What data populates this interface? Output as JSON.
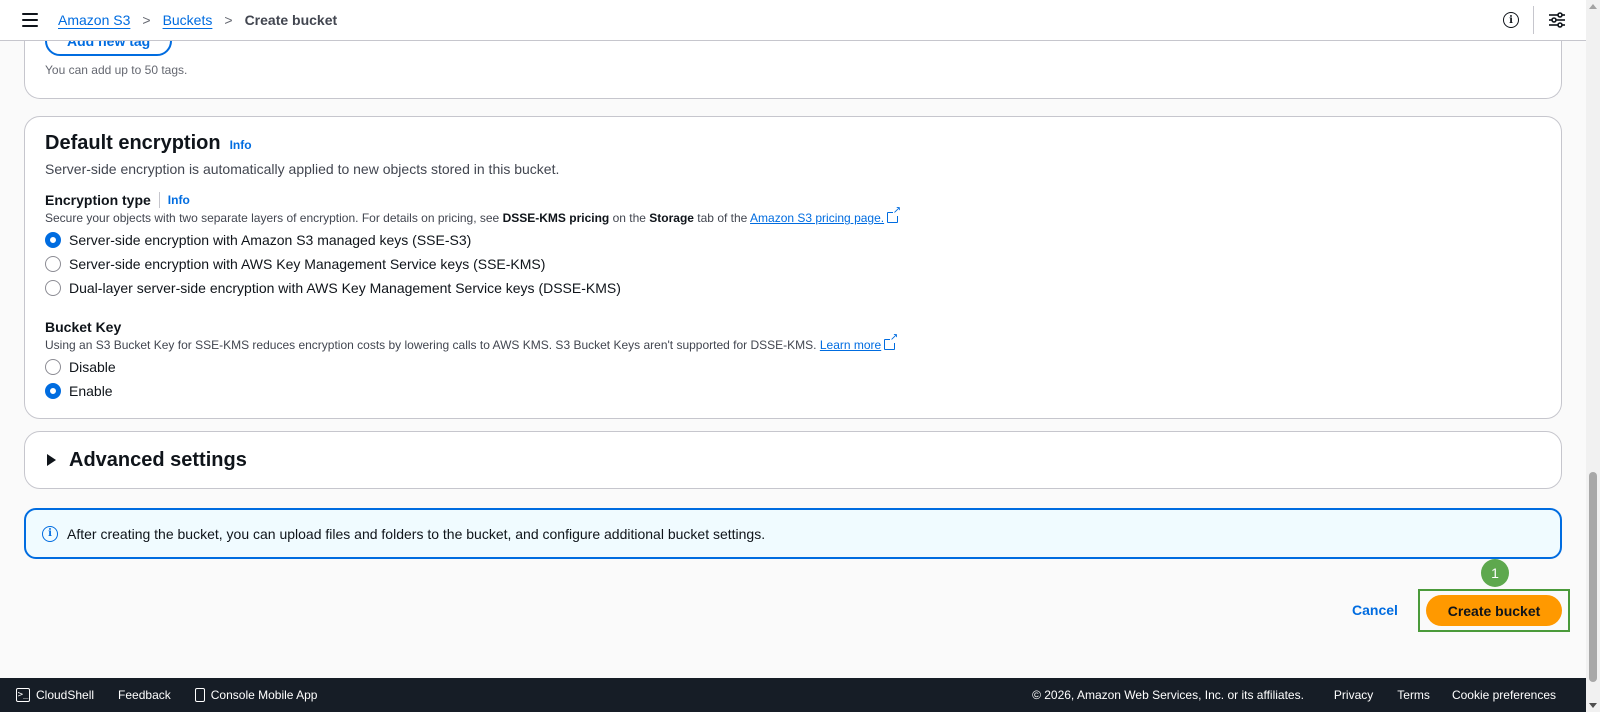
{
  "breadcrumbs": {
    "items": [
      "Amazon S3",
      "Buckets"
    ],
    "current": "Create bucket",
    "separator": ">"
  },
  "topbar_icons": [
    "hamburger-menu-icon",
    "info-icon",
    "tools-icon"
  ],
  "tags_section": {
    "add_tag_button": "Add new tag",
    "hint": "You can add up to 50 tags."
  },
  "default_encryption": {
    "title": "Default encryption",
    "info": "Info",
    "description": "Server-side encryption is automatically applied to new objects stored in this bucket.",
    "encryption_type": {
      "label": "Encryption type",
      "info": "Info",
      "hint_prefix": "Secure your objects with two separate layers of encryption. For details on pricing, see ",
      "hint_bold1": "DSSE-KMS pricing",
      "hint_mid": " on the ",
      "hint_bold2": "Storage",
      "hint_suffix": " tab of the ",
      "hint_link": "Amazon S3 pricing page.",
      "options": [
        {
          "label": "Server-side encryption with Amazon S3 managed keys (SSE-S3)",
          "selected": true
        },
        {
          "label": "Server-side encryption with AWS Key Management Service keys (SSE-KMS)",
          "selected": false
        },
        {
          "label": "Dual-layer server-side encryption with AWS Key Management Service keys (DSSE-KMS)",
          "selected": false
        }
      ]
    },
    "bucket_key": {
      "label": "Bucket Key",
      "hint": "Using an S3 Bucket Key for SSE-KMS reduces encryption costs by lowering calls to AWS KMS. S3 Bucket Keys aren't supported for DSSE-KMS. ",
      "hint_link": "Learn more",
      "options": [
        {
          "label": "Disable",
          "selected": false
        },
        {
          "label": "Enable",
          "selected": true
        }
      ]
    }
  },
  "advanced_settings": {
    "title": "Advanced settings"
  },
  "alert": {
    "text": "After creating the bucket, you can upload files and folders to the bucket, and configure additional bucket settings."
  },
  "actions": {
    "cancel": "Cancel",
    "create": "Create bucket",
    "marker": "1"
  },
  "footer": {
    "cloudshell": "CloudShell",
    "feedback": "Feedback",
    "mobile_app": "Console Mobile App",
    "copyright": "© 2026, Amazon Web Services, Inc. or its affiliates.",
    "privacy": "Privacy",
    "terms": "Terms",
    "cookies": "Cookie preferences"
  },
  "colors": {
    "accent": "#006ce0",
    "primary_button": "#ff9900",
    "footer_bg": "#161d26",
    "alert_bg": "#f0fbff",
    "marker": "#5ea84e"
  }
}
